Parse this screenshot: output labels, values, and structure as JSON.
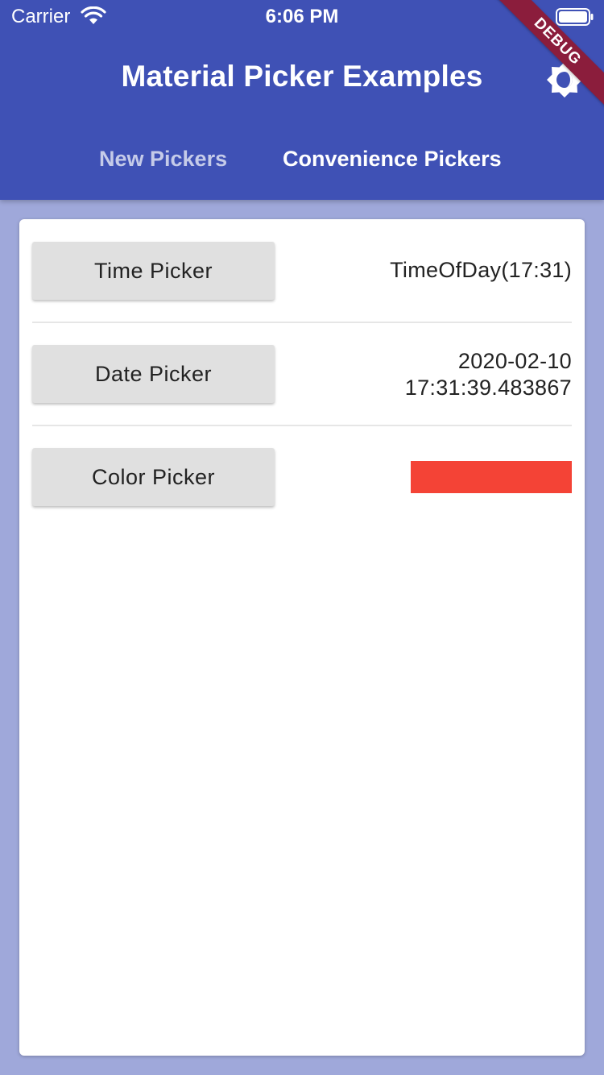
{
  "status_bar": {
    "carrier": "Carrier",
    "time": "6:06 PM"
  },
  "app_bar": {
    "title": "Material Picker Examples",
    "theme_icon": "brightness-icon",
    "debug_banner": "DEBUG",
    "tabs": [
      {
        "label": "New Pickers",
        "selected": false
      },
      {
        "label": "Convenience Pickers",
        "selected": true
      }
    ]
  },
  "pickers": {
    "time": {
      "button_label": "Time Picker",
      "value": "TimeOfDay(17:31)"
    },
    "date": {
      "button_label": "Date Picker",
      "value_date": "2020-02-10",
      "value_time": "17:31:39.483867"
    },
    "color": {
      "button_label": "Color Picker",
      "value_color": "#f44336"
    }
  },
  "colors": {
    "primary": "#3f51b5",
    "background": "#9fa8da",
    "button": "#e0e0e0"
  }
}
